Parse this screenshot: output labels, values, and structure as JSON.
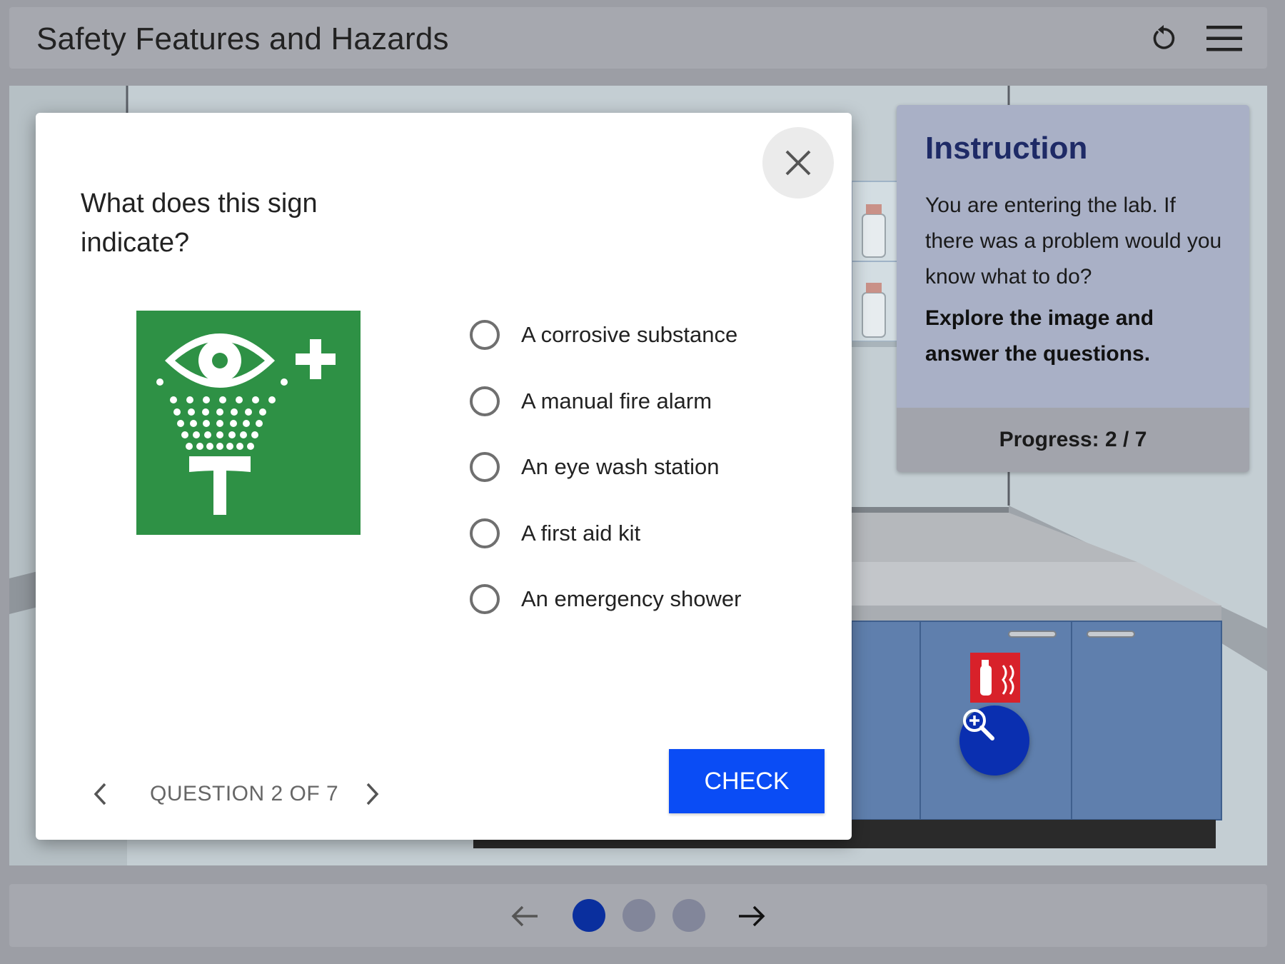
{
  "header": {
    "title": "Safety Features and Hazards",
    "reset_icon": "reset-icon",
    "menu_icon": "hamburger-menu-icon"
  },
  "instruction": {
    "title": "Instruction",
    "text": "You are entering the lab. If there was a problem would you know what to do?",
    "bold_text": "Explore the image and answer the questions.",
    "progress": "Progress: 2 / 7"
  },
  "scene": {
    "zoom_icon": "zoom-in-icon",
    "fire_extinguisher_sign": "fire-extinguisher-sign-icon"
  },
  "modal": {
    "close_icon": "close-icon",
    "question": "What does this sign indicate?",
    "sign_icon": "eye-wash-station-sign-icon",
    "options": [
      {
        "label": "A corrosive substance",
        "selected": false
      },
      {
        "label": "A manual fire alarm",
        "selected": false
      },
      {
        "label": "An eye wash station",
        "selected": false
      },
      {
        "label": "A first aid kit",
        "selected": false
      },
      {
        "label": "An emergency shower",
        "selected": false
      }
    ],
    "check_label": "CHECK",
    "counter": "QUESTION 2 OF 7"
  },
  "pager": {
    "current_page": 1,
    "total_pages": 3
  },
  "colors": {
    "accent": "#0a4cf5",
    "instruction_title": "#1e2a66",
    "sign_green": "#2e9145",
    "pager_active": "#0a2f9e"
  }
}
